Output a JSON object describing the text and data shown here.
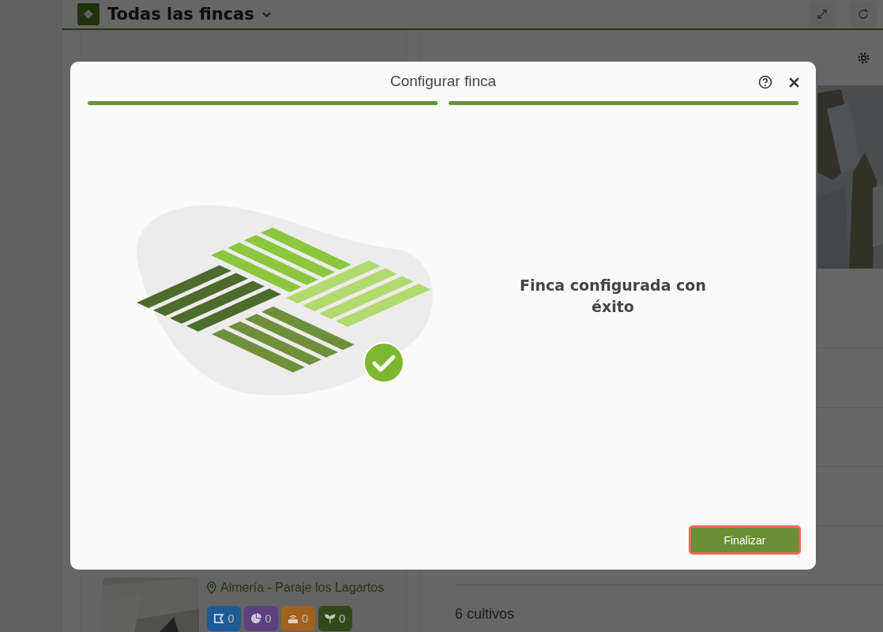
{
  "header": {
    "title": "Todas las fincas"
  },
  "farm_card": {
    "location": "Almería - Paraje los Lagartos",
    "badges": [
      {
        "kind": "plots",
        "count": "0",
        "color": "#1e5a96"
      },
      {
        "kind": "analysis",
        "count": "0",
        "color": "#5c4080"
      },
      {
        "kind": "devices",
        "count": "0",
        "color": "#a0621e"
      },
      {
        "kind": "crops",
        "count": "0",
        "color": "#30481a"
      }
    ]
  },
  "details": {
    "crops": "6 cultivos"
  },
  "dialog": {
    "title": "Configurar finca",
    "steps": [
      {
        "done": true
      },
      {
        "done": true
      }
    ],
    "message": "Finca configurada con éxito",
    "button": "Finalizar"
  }
}
